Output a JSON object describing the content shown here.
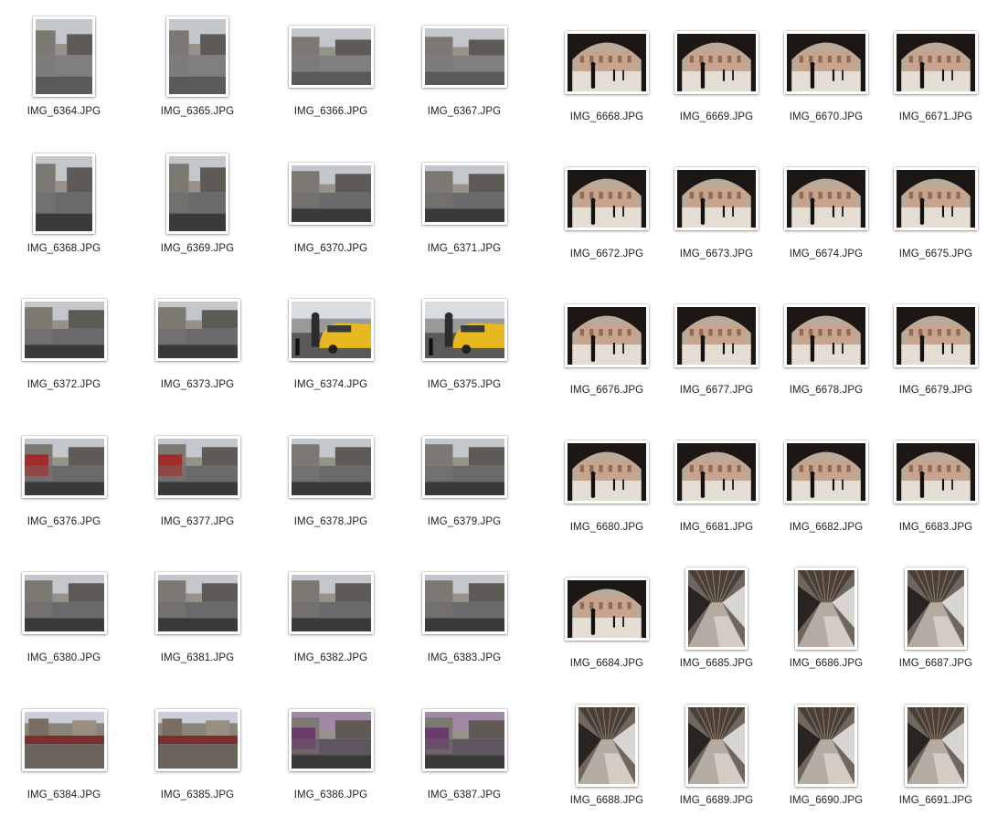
{
  "left_panel": {
    "files": [
      {
        "name": "IMG_6364.JPG",
        "orientation": "portrait",
        "scene": "street"
      },
      {
        "name": "IMG_6365.JPG",
        "orientation": "portrait",
        "scene": "street"
      },
      {
        "name": "IMG_6366.JPG",
        "orientation": "landscape",
        "scene": "street"
      },
      {
        "name": "IMG_6367.JPG",
        "orientation": "landscape",
        "scene": "street"
      },
      {
        "name": "IMG_6368.JPG",
        "orientation": "portrait",
        "scene": "reflection"
      },
      {
        "name": "IMG_6369.JPG",
        "orientation": "portrait",
        "scene": "reflection"
      },
      {
        "name": "IMG_6370.JPG",
        "orientation": "landscape",
        "scene": "reflection"
      },
      {
        "name": "IMG_6371.JPG",
        "orientation": "landscape",
        "scene": "reflection"
      },
      {
        "name": "IMG_6372.JPG",
        "orientation": "landscape",
        "scene": "reflection"
      },
      {
        "name": "IMG_6373.JPG",
        "orientation": "landscape",
        "scene": "reflection"
      },
      {
        "name": "IMG_6374.JPG",
        "orientation": "landscape",
        "scene": "taxi"
      },
      {
        "name": "IMG_6375.JPG",
        "orientation": "landscape",
        "scene": "taxi"
      },
      {
        "name": "IMG_6376.JPG",
        "orientation": "landscape",
        "scene": "reflection-red"
      },
      {
        "name": "IMG_6377.JPG",
        "orientation": "landscape",
        "scene": "reflection-red"
      },
      {
        "name": "IMG_6378.JPG",
        "orientation": "landscape",
        "scene": "reflection"
      },
      {
        "name": "IMG_6379.JPG",
        "orientation": "landscape",
        "scene": "reflection"
      },
      {
        "name": "IMG_6380.JPG",
        "orientation": "landscape",
        "scene": "reflection"
      },
      {
        "name": "IMG_6381.JPG",
        "orientation": "landscape",
        "scene": "reflection"
      },
      {
        "name": "IMG_6382.JPG",
        "orientation": "landscape",
        "scene": "reflection"
      },
      {
        "name": "IMG_6383.JPG",
        "orientation": "landscape",
        "scene": "reflection"
      },
      {
        "name": "IMG_6384.JPG",
        "orientation": "landscape",
        "scene": "plaza"
      },
      {
        "name": "IMG_6385.JPG",
        "orientation": "landscape",
        "scene": "plaza"
      },
      {
        "name": "IMG_6386.JPG",
        "orientation": "landscape",
        "scene": "reflection-purple"
      },
      {
        "name": "IMG_6387.JPG",
        "orientation": "landscape",
        "scene": "reflection-purple"
      }
    ]
  },
  "right_panel": {
    "files": [
      {
        "name": "IMG_6668.JPG",
        "orientation": "landscape",
        "scene": "arch"
      },
      {
        "name": "IMG_6669.JPG",
        "orientation": "landscape",
        "scene": "arch"
      },
      {
        "name": "IMG_6670.JPG",
        "orientation": "landscape",
        "scene": "arch"
      },
      {
        "name": "IMG_6671.JPG",
        "orientation": "landscape",
        "scene": "arch"
      },
      {
        "name": "IMG_6672.JPG",
        "orientation": "landscape",
        "scene": "arch"
      },
      {
        "name": "IMG_6673.JPG",
        "orientation": "landscape",
        "scene": "arch"
      },
      {
        "name": "IMG_6674.JPG",
        "orientation": "landscape",
        "scene": "arch"
      },
      {
        "name": "IMG_6675.JPG",
        "orientation": "landscape",
        "scene": "arch"
      },
      {
        "name": "IMG_6676.JPG",
        "orientation": "landscape",
        "scene": "arch"
      },
      {
        "name": "IMG_6677.JPG",
        "orientation": "landscape",
        "scene": "arch"
      },
      {
        "name": "IMG_6678.JPG",
        "orientation": "landscape",
        "scene": "arch"
      },
      {
        "name": "IMG_6679.JPG",
        "orientation": "landscape",
        "scene": "arch"
      },
      {
        "name": "IMG_6680.JPG",
        "orientation": "landscape",
        "scene": "arch"
      },
      {
        "name": "IMG_6681.JPG",
        "orientation": "landscape",
        "scene": "arch"
      },
      {
        "name": "IMG_6682.JPG",
        "orientation": "landscape",
        "scene": "arch"
      },
      {
        "name": "IMG_6683.JPG",
        "orientation": "landscape",
        "scene": "arch"
      },
      {
        "name": "IMG_6684.JPG",
        "orientation": "landscape",
        "scene": "arch"
      },
      {
        "name": "IMG_6685.JPG",
        "orientation": "portrait",
        "scene": "platform"
      },
      {
        "name": "IMG_6686.JPG",
        "orientation": "portrait",
        "scene": "platform"
      },
      {
        "name": "IMG_6687.JPG",
        "orientation": "portrait",
        "scene": "platform"
      },
      {
        "name": "IMG_6688.JPG",
        "orientation": "portrait",
        "scene": "platform"
      },
      {
        "name": "IMG_6689.JPG",
        "orientation": "portrait",
        "scene": "platform"
      },
      {
        "name": "IMG_6690.JPG",
        "orientation": "portrait",
        "scene": "platform"
      },
      {
        "name": "IMG_6691.JPG",
        "orientation": "portrait",
        "scene": "platform"
      }
    ]
  }
}
